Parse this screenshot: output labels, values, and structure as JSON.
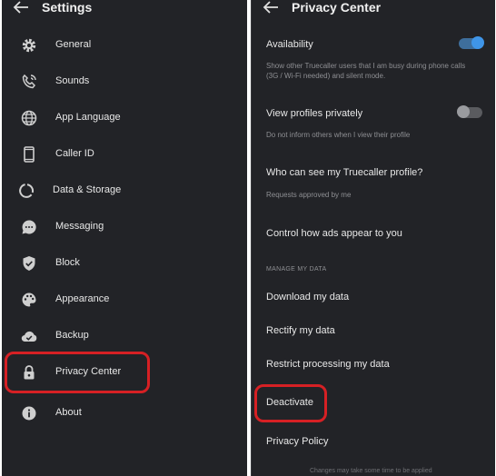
{
  "left": {
    "title": "Settings",
    "items": [
      {
        "label": "General",
        "icon": "gear-icon"
      },
      {
        "label": "Sounds",
        "icon": "phone-ringing-icon"
      },
      {
        "label": "App Language",
        "icon": "globe-icon"
      },
      {
        "label": "Caller ID",
        "icon": "phone-device-icon"
      },
      {
        "label": "Data & Storage",
        "icon": "data-usage-icon"
      },
      {
        "label": "Messaging",
        "icon": "chat-bubble-icon"
      },
      {
        "label": "Block",
        "icon": "shield-check-icon"
      },
      {
        "label": "Appearance",
        "icon": "palette-icon"
      },
      {
        "label": "Backup",
        "icon": "cloud-check-icon"
      },
      {
        "label": "Privacy Center",
        "icon": "lock-icon"
      },
      {
        "label": "About",
        "icon": "info-icon"
      }
    ]
  },
  "right": {
    "title": "Privacy Center",
    "availability": {
      "title": "Availability",
      "subtitle": "Show other Truecaller users that I am busy during phone calls (3G / Wi-Fi needed) and silent mode.",
      "enabled": true
    },
    "view_privately": {
      "title": "View profiles privately",
      "subtitle": "Do not inform others when I view their profile",
      "enabled": false
    },
    "who_can_see": {
      "title": "Who can see my Truecaller profile?",
      "subtitle": "Requests approved by me"
    },
    "ads": {
      "title": "Control how ads appear to you"
    },
    "manage_header": "MANAGE MY DATA",
    "download": "Download my data",
    "rectify": "Rectify my data",
    "restrict": "Restrict processing my data",
    "deactivate": "Deactivate",
    "privacy_policy": "Privacy Policy",
    "footer": "Changes may take some time to be applied"
  },
  "colors": {
    "background": "#222327",
    "highlight": "#d62024",
    "toggle_on": "#3f95e8"
  }
}
